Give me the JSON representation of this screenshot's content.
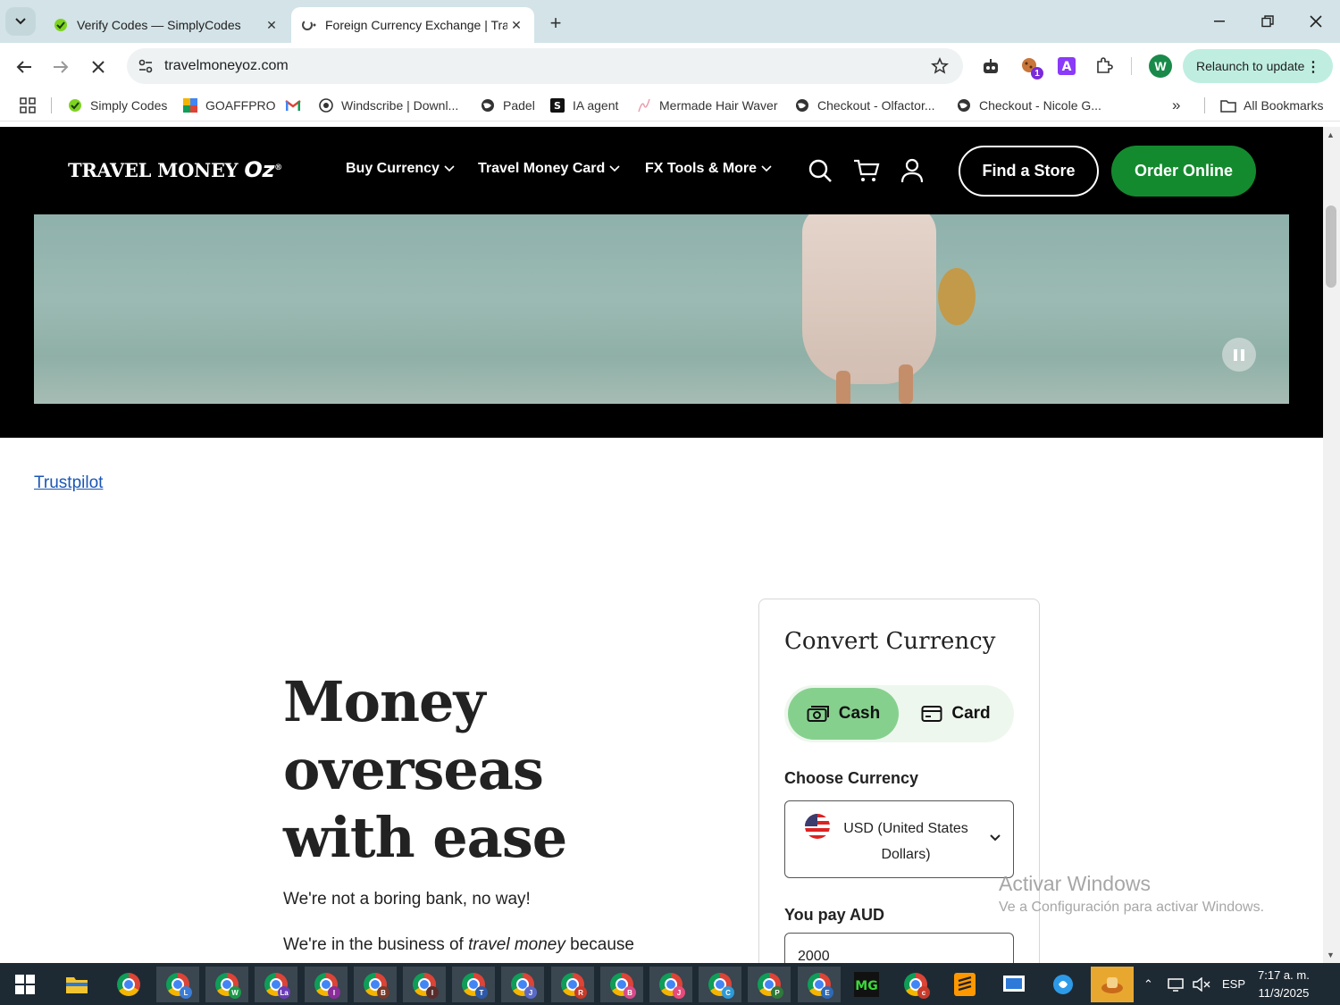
{
  "browser": {
    "tabs": [
      {
        "title": "Verify Codes — SimplyCodes",
        "active": false
      },
      {
        "title": "Foreign Currency Exchange | Tra",
        "active": true
      }
    ],
    "new_tab": "+",
    "url": "travelmoneyoz.com",
    "relaunch_label": "Relaunch to update",
    "profile_initial": "W",
    "extension_badge": "1",
    "bookmarks": [
      {
        "label": "Simply Codes",
        "icon": "simplycodes-icon"
      },
      {
        "label": "GOAFFPRO",
        "icon": "goaffpro-icon"
      },
      {
        "label": "",
        "icon": "gmail-icon"
      },
      {
        "label": "Windscribe | Downl...",
        "icon": "windscribe-icon"
      },
      {
        "label": "Padel",
        "icon": "globe-icon"
      },
      {
        "label": "IA agent",
        "icon": "ia-agent-icon"
      },
      {
        "label": "Mermade Hair Waver",
        "icon": "mermade-icon"
      },
      {
        "label": "Checkout - Olfactor...",
        "icon": "globe-icon"
      },
      {
        "label": "Checkout - Nicole G...",
        "icon": "globe-icon"
      }
    ],
    "more_bookmarks": "»",
    "all_bookmarks": "All Bookmarks"
  },
  "site": {
    "logo": {
      "main": "TRAVEL MONEY",
      "script": "Oz",
      "mark": "®"
    },
    "nav": [
      {
        "label": "Buy Currency"
      },
      {
        "label": "Travel Money Card"
      },
      {
        "label": "FX Tools & More"
      }
    ],
    "find_store": "Find a Store",
    "order_online": "Order Online",
    "trustpilot": "Trustpilot",
    "headline": "Money overseas with ease",
    "tagline": "We're not a boring bank, no way!",
    "para2_pre": "We're in the business of ",
    "para2_em": "travel money",
    "para2_post": " because"
  },
  "converter": {
    "title": "Convert Currency",
    "cash_label": "Cash",
    "card_label": "Card",
    "selected_mode": "Cash",
    "choose_currency_label": "Choose Currency",
    "currency_line1": "USD (United States",
    "currency_line2": "Dollars)",
    "you_pay_label": "You pay AUD",
    "you_pay_value": "2000"
  },
  "watermark": {
    "line1": "Activar Windows",
    "line2": "Ve a Configuración para activar Windows."
  },
  "taskbar": {
    "apps": [
      {
        "badge": "L",
        "color": "#3b7dd8"
      },
      {
        "badge": "W",
        "color": "#1a9a4a"
      },
      {
        "badge": "La",
        "color": "#6a3db8"
      },
      {
        "badge": "I",
        "color": "#8a2d9a"
      },
      {
        "badge": "B",
        "color": "#7a3a2a"
      },
      {
        "badge": "I",
        "color": "#5a2d2d"
      },
      {
        "badge": "T",
        "color": "#2d5aa8"
      },
      {
        "badge": "J",
        "color": "#5a6ac8"
      },
      {
        "badge": "R",
        "color": "#c83a2a"
      },
      {
        "badge": "B",
        "color": "#d84a8a"
      },
      {
        "badge": "J",
        "color": "#e84a7a"
      },
      {
        "badge": "C",
        "color": "#2d9ad8"
      },
      {
        "badge": "P",
        "color": "#2d7a3a"
      },
      {
        "badge": "E",
        "color": "#2d6ab8"
      }
    ],
    "language": "ESP",
    "time": "7:17 a. m.",
    "date": "11/3/2025"
  },
  "colors": {
    "tabbar": "#d3e3e8",
    "header_bg": "#000000",
    "order_online_bg": "#148a2e",
    "cash_active_bg": "#86d08e",
    "relaunch_bg": "#bfeee0",
    "link": "#1a56b5"
  }
}
